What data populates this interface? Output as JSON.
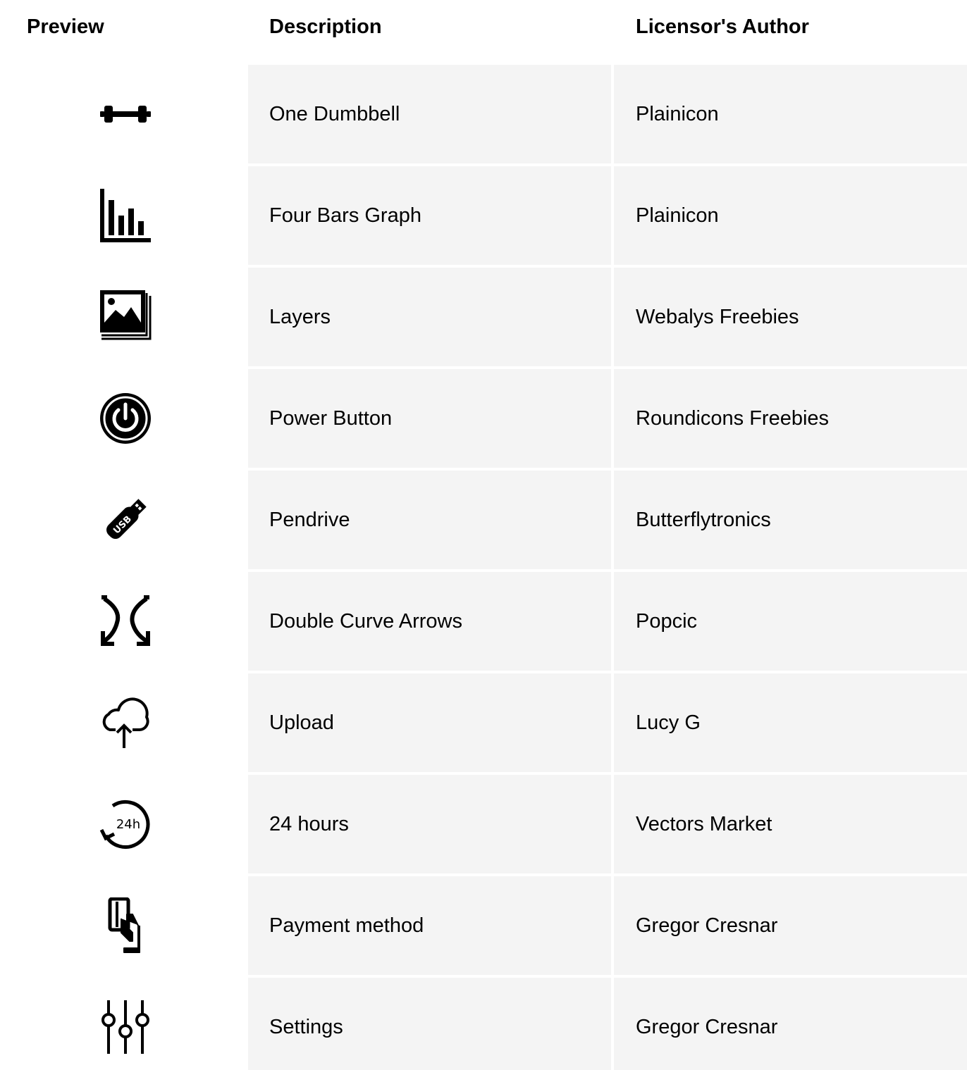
{
  "table": {
    "headers": {
      "preview": "Preview",
      "description": "Description",
      "author": "Licensor's Author"
    },
    "rows": [
      {
        "icon": "dumbbell-icon",
        "description": "One Dumbbell",
        "author": "Plainicon"
      },
      {
        "icon": "bar-graph-icon",
        "description": "Four Bars Graph",
        "author": "Plainicon"
      },
      {
        "icon": "layers-icon",
        "description": "Layers",
        "author": "Webalys Freebies"
      },
      {
        "icon": "power-button-icon",
        "description": "Power Button",
        "author": "Roundicons Freebies"
      },
      {
        "icon": "usb-pendrive-icon",
        "description": "Pendrive",
        "author": "Butterflytronics"
      },
      {
        "icon": "double-curve-arrows-icon",
        "description": "Double Curve Arrows",
        "author": "Popcic"
      },
      {
        "icon": "cloud-upload-icon",
        "description": "Upload",
        "author": "Lucy G"
      },
      {
        "icon": "24-hours-icon",
        "description": "24 hours",
        "author": "Vectors Market",
        "icon_text": "24h"
      },
      {
        "icon": "payment-method-icon",
        "description": "Payment method",
        "author": "Gregor Cresnar"
      },
      {
        "icon": "settings-sliders-icon",
        "description": "Settings",
        "author": "Gregor Cresnar"
      }
    ]
  }
}
